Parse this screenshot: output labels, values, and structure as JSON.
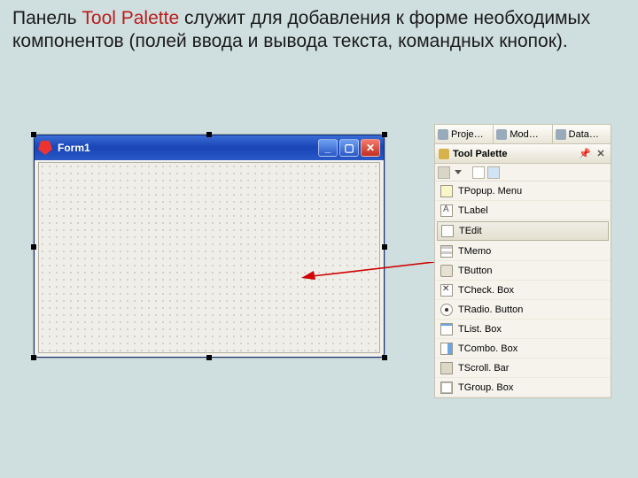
{
  "slide": {
    "prefix": "Панель ",
    "highlight": "Tool Palette",
    "suffix": " служит для добавления  к форме необходимых компонентов (полей ввода и вывода текста, командных кнопок)."
  },
  "form_window": {
    "title": "Form1",
    "btn_min": "_",
    "btn_max": "▢",
    "btn_close": "✕"
  },
  "tabs": [
    {
      "label": "Proje…"
    },
    {
      "label": "Mod…"
    },
    {
      "label": "Data…"
    }
  ],
  "palette": {
    "title": "Tool Palette",
    "pin_icon": "pin-icon",
    "close_icon": "close-icon"
  },
  "toolrow": {
    "dropdown_icon": "categories-dropdown",
    "pointer_icon": "pointer-icon",
    "filter_icon": "filter-icon"
  },
  "items": [
    {
      "key": "popupmenu",
      "label": "TPopup. Menu",
      "icon": "menu",
      "selected": false
    },
    {
      "key": "label",
      "label": "TLabel",
      "icon": "label",
      "selected": false
    },
    {
      "key": "edit",
      "label": "TEdit",
      "icon": "edit",
      "selected": true
    },
    {
      "key": "memo",
      "label": "TMemo",
      "icon": "memo",
      "selected": false
    },
    {
      "key": "button",
      "label": "TButton",
      "icon": "button",
      "selected": false
    },
    {
      "key": "checkbox",
      "label": "TCheck. Box",
      "icon": "check",
      "selected": false
    },
    {
      "key": "radio",
      "label": "TRadio. Button",
      "icon": "radio",
      "selected": false
    },
    {
      "key": "listbox",
      "label": "TList. Box",
      "icon": "list",
      "selected": false
    },
    {
      "key": "combobox",
      "label": "TCombo. Box",
      "icon": "combo",
      "selected": false
    },
    {
      "key": "scrollbar",
      "label": "TScroll. Bar",
      "icon": "scroll",
      "selected": false
    },
    {
      "key": "groupbox",
      "label": "TGroup. Box",
      "icon": "group",
      "selected": false
    }
  ]
}
